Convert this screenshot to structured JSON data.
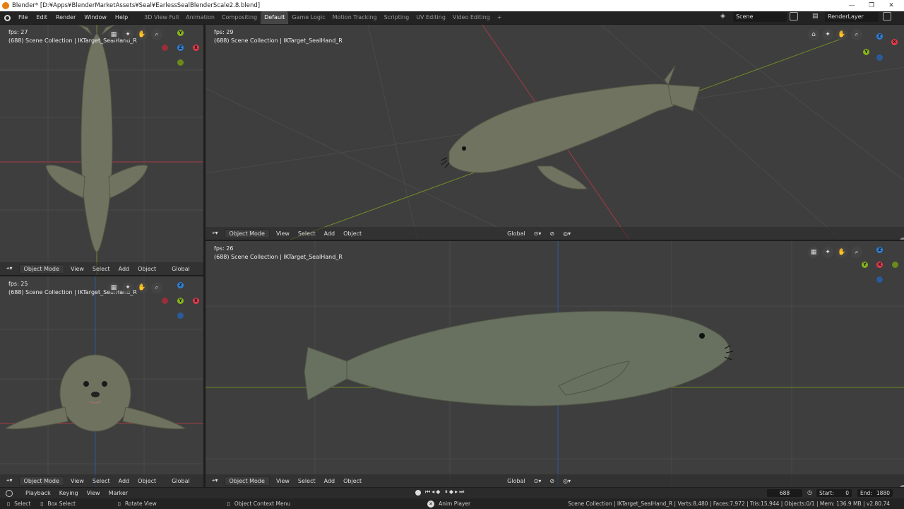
{
  "window": {
    "title": "Blender* [D:¥Apps¥BlenderMarketAssets¥Seal¥EarlessSealBlenderScale2.8.blend]",
    "minimize": "—",
    "maximize": "❐",
    "close": "✕"
  },
  "menu": [
    "File",
    "Edit",
    "Render",
    "Window",
    "Help"
  ],
  "workspaces": [
    "3D View Full",
    "Animation",
    "Compositing",
    "Default",
    "Game Logic",
    "Motion Tracking",
    "Scripting",
    "UV Editing",
    "Video Editing",
    "+"
  ],
  "active_workspace": "Default",
  "scene": "Scene",
  "render_layer": "RenderLayer",
  "collection_text": "(688) Scene Collection | IKTarget_SealHand_R",
  "viewports": {
    "top_left": {
      "fps": "fps: 27"
    },
    "bottom_left": {
      "fps": "fps: 25"
    },
    "top_right": {
      "fps": "fps: 29"
    },
    "bottom_right": {
      "fps": "fps: 26"
    }
  },
  "viewport_header": {
    "mode": "Object Mode",
    "view": "View",
    "select": "Select",
    "add": "Add",
    "object": "Object",
    "orientation": "Global"
  },
  "gizmo": {
    "y": "Y",
    "z": "Z",
    "x": "X"
  },
  "timeline": {
    "playback": "Playback",
    "keying": "Keying",
    "view": "View",
    "marker": "Marker",
    "frame": "688",
    "start_label": "Start:",
    "start": "0",
    "end_label": "End:",
    "end": "1880"
  },
  "status": {
    "select": "Select",
    "box_select": "Box Select",
    "rotate_view": "Rotate View",
    "context_menu": "Object Context Menu",
    "anim_player": "Anim Player",
    "stats": "Scene Collection | IKTarget_SealHand_R | Verts:8,480 | Faces:7,972 | Tris:15,944 | Objects:0/1 | Mem: 136.9 MB | v2.80.74"
  },
  "colors": {
    "accent": "#4772b3",
    "x_axis": "#e23a4a",
    "y_axis": "#86b21b",
    "z_axis": "#2f7fd7",
    "viewport_bg": "#3e3e3e"
  }
}
